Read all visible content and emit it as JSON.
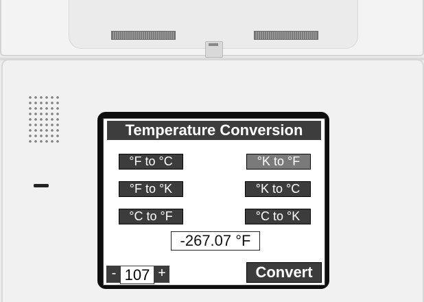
{
  "screen": {
    "title": "Temperature Conversion"
  },
  "conversions": [
    {
      "label": "°F to °C",
      "active": false
    },
    {
      "label": "°K to °F",
      "active": true
    },
    {
      "label": "°F to °K",
      "active": false
    },
    {
      "label": "°K to °C",
      "active": false
    },
    {
      "label": "°C to °F",
      "active": false
    },
    {
      "label": "°C to °K",
      "active": false
    }
  ],
  "result": {
    "value": "-267.07 °F"
  },
  "input": {
    "minus_label": "-",
    "value": "107",
    "plus_label": "+"
  },
  "actions": {
    "convert_label": "Convert"
  },
  "colors": {
    "button_bg": "#3c3c3c",
    "button_active_bg": "#7a7a7a",
    "screen_bg": "#ffffff",
    "bezel": "#0e0e0e"
  }
}
